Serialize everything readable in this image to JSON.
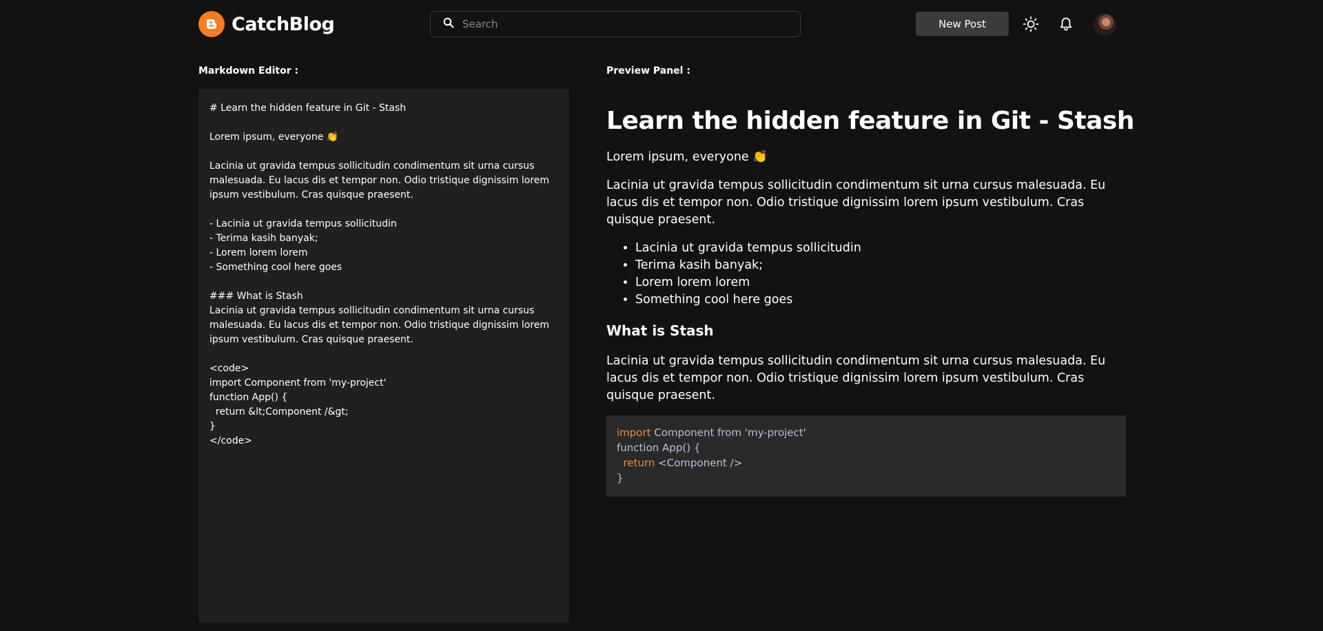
{
  "header": {
    "brand": "CatchBlog",
    "search_placeholder": "Search",
    "new_post_label": "New Post"
  },
  "editor": {
    "label": "Markdown Editor :",
    "content": "# Learn the hidden feature in Git - Stash\n\nLorem ipsum, everyone 👏\n\nLacinia ut gravida tempus sollicitudin condimentum sit urna cursus malesuada. Eu lacus dis et tempor non. Odio tristique dignissim lorem ipsum vestibulum. Cras quisque praesent.\n\n- Lacinia ut gravida tempus sollicitudin\n- Terima kasih banyak;\n- Lorem lorem lorem\n- Something cool here goes\n\n### What is Stash\nLacinia ut gravida tempus sollicitudin condimentum sit urna cursus malesuada. Eu lacus dis et tempor non. Odio tristique dignissim lorem ipsum vestibulum. Cras quisque praesent.\n\n<code>\nimport Component from 'my-project'\nfunction App() {\n  return &lt;Component /&gt;\n}\n</code>"
  },
  "preview": {
    "label": "Preview Panel :",
    "title": "Learn the hidden feature in Git - Stash",
    "intro": "Lorem ipsum, everyone 👏",
    "paragraph1": "Lacinia ut gravida tempus sollicitudin condimentum sit urna cursus malesuada. Eu lacus dis et tempor non. Odio tristique dignissim lorem ipsum vestibulum. Cras quisque praesent.",
    "list": [
      "Lacinia ut gravida tempus sollicitudin",
      "Terima kasih banyak;",
      "Lorem lorem lorem",
      "Something cool here goes"
    ],
    "subheading": "What is Stash",
    "paragraph2": "Lacinia ut gravida tempus sollicitudin condimentum sit urna cursus malesuada. Eu lacus dis et tempor non. Odio tristique dignissim lorem ipsum vestibulum. Cras quisque praesent.",
    "code": {
      "line1_kw": "import",
      "line1_rest": " Component from 'my-project'",
      "line2": "function App() {",
      "line3_kw": "return",
      "line3_rest": " <Component />",
      "line4": "}"
    }
  },
  "colors": {
    "background": "#121212",
    "brand_orange": "#f57c1f",
    "editor_bg": "#202020",
    "code_bg": "#2a2a2a",
    "code_keyword": "#f08a3c"
  },
  "icons": {
    "logo": "blogger-logo-icon",
    "search": "search-icon",
    "theme": "sun-icon",
    "notifications": "bell-icon"
  }
}
